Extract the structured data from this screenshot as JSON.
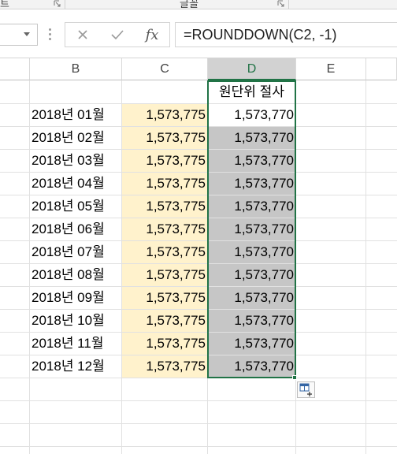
{
  "ribbon": {
    "left_label": "트",
    "center_label": "글꼴"
  },
  "formula_bar": {
    "name_box_value": "",
    "formula": "=ROUNDDOWN(C2, -1)",
    "cancel_icon": "close-icon",
    "enter_icon": "check-icon",
    "fx_label": "fx"
  },
  "columns": [
    {
      "label": "B"
    },
    {
      "label": "C"
    },
    {
      "label": "D"
    },
    {
      "label": "E"
    }
  ],
  "header_row": {
    "d": "원단위 절사"
  },
  "rows": [
    {
      "label": "2018년 01월",
      "c": "1,573,775",
      "d": "1,573,770"
    },
    {
      "label": "2018년 02월",
      "c": "1,573,775",
      "d": "1,573,770"
    },
    {
      "label": "2018년 03월",
      "c": "1,573,775",
      "d": "1,573,770"
    },
    {
      "label": "2018년 04월",
      "c": "1,573,775",
      "d": "1,573,770"
    },
    {
      "label": "2018년 05월",
      "c": "1,573,775",
      "d": "1,573,770"
    },
    {
      "label": "2018년 06월",
      "c": "1,573,775",
      "d": "1,573,770"
    },
    {
      "label": "2018년 07월",
      "c": "1,573,775",
      "d": "1,573,770"
    },
    {
      "label": "2018년 08월",
      "c": "1,573,775",
      "d": "1,573,770"
    },
    {
      "label": "2018년 09월",
      "c": "1,573,775",
      "d": "1,573,770"
    },
    {
      "label": "2018년 10월",
      "c": "1,573,775",
      "d": "1,573,770"
    },
    {
      "label": "2018년 11월",
      "c": "1,573,775",
      "d": "1,573,770"
    },
    {
      "label": "2018년 12월",
      "c": "1,573,775",
      "d": "1,573,770"
    }
  ],
  "colors": {
    "accent": "#217346",
    "highlight_fill": "#fff2cc",
    "selection_fill": "#c6c6c6"
  }
}
